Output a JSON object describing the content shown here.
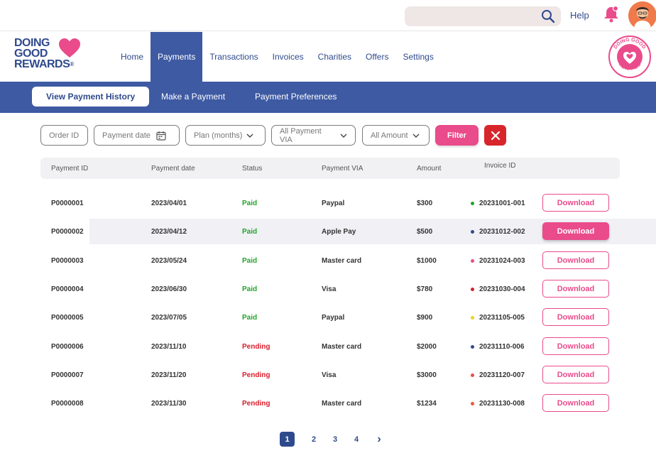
{
  "topbar": {
    "search_placeholder": "",
    "help_label": "Help"
  },
  "logo": {
    "line1": "DOING",
    "line2": "GOOD",
    "line3": "REWARDS",
    "mark": "®",
    "badge_top": "DOING GOOD",
    "badge_bottom": "REWARDS"
  },
  "nav": {
    "items": [
      "Home",
      "Payments",
      "Transactions",
      "Invoices",
      "Charities",
      "Offers",
      "Settings"
    ],
    "active": "Payments"
  },
  "subnav": {
    "tabs": [
      "View Payment History",
      "Make a Payment",
      "Payment Preferences"
    ],
    "active": "View Payment History"
  },
  "filters": {
    "order_id": "Order ID",
    "payment_date": "Payment date",
    "plan": "Plan (months)",
    "payment_via": "All Payment VIA",
    "amount": "All Amount",
    "filter_button": "Filter"
  },
  "table": {
    "headers": [
      "Payment ID",
      "Payment date",
      "Status",
      "Payment VIA",
      "Amount",
      "Invoice ID"
    ],
    "rows": [
      {
        "id": "P0000001",
        "date": "2023/04/01",
        "status": "Paid",
        "via": "Paypal",
        "amount": "$300",
        "invoice": "20231001-001",
        "dot": "#22a32a",
        "button": "Download"
      },
      {
        "id": "P0000002",
        "date": "2023/04/12",
        "status": "Paid",
        "via": "Apple Pay",
        "amount": "$500",
        "invoice": "20231012-002",
        "dot": "#2f4a8c",
        "button": "Download"
      },
      {
        "id": "P0000003",
        "date": "2023/05/24",
        "status": "Paid",
        "via": "Master card",
        "amount": "$1000",
        "invoice": "20231024-003",
        "dot": "#ea4b8b",
        "button": "Download"
      },
      {
        "id": "P0000004",
        "date": "2023/06/30",
        "status": "Paid",
        "via": "Visa",
        "amount": "$780",
        "invoice": "20231030-004",
        "dot": "#d81e2a",
        "button": "Download"
      },
      {
        "id": "P0000005",
        "date": "2023/07/05",
        "status": "Paid",
        "via": "Paypal",
        "amount": "$900",
        "invoice": "20231105-005",
        "dot": "#f2d21a",
        "button": "Download"
      },
      {
        "id": "P0000006",
        "date": "2023/11/10",
        "status": "Pending",
        "via": "Master card",
        "amount": "$2000",
        "invoice": "20231110-006",
        "dot": "#2f4a8c",
        "button": "Download"
      },
      {
        "id": "P0000007",
        "date": "2023/11/20",
        "status": "Pending",
        "via": "Visa",
        "amount": "$3000",
        "invoice": "20231120-007",
        "dot": "#ea4b4b",
        "button": "Download"
      },
      {
        "id": "P0000008",
        "date": "2023/11/30",
        "status": "Pending",
        "via": "Master card",
        "amount": "$1234",
        "invoice": "20231130-008",
        "dot": "#ea5a3a",
        "button": "Download"
      }
    ]
  },
  "pagination": {
    "pages": [
      "1",
      "2",
      "3",
      "4"
    ],
    "current": "1",
    "next": "›"
  },
  "colors": {
    "brand_blue": "#3e5aa3",
    "brand_pink": "#ea4b8b",
    "paid": "#22a32a",
    "pending": "#d81e2a"
  }
}
